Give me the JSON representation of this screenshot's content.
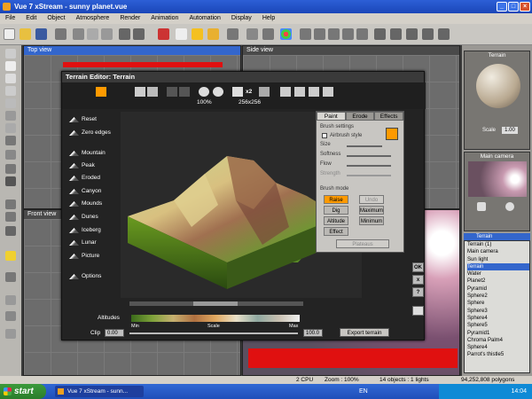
{
  "window": {
    "title": "Vue 7 xStream - sunny planet.vue"
  },
  "menu": [
    "File",
    "Edit",
    "Object",
    "Atmosphere",
    "Render",
    "Animation",
    "Automation",
    "Display",
    "Help"
  ],
  "viewports": {
    "top": "Top view",
    "side": "Side view",
    "front": "Front view",
    "main_camera": "Main camera"
  },
  "terrain_editor": {
    "title": "Terrain Editor: Terrain",
    "zoom": "100%",
    "resolution": "256x256",
    "x2_label": "x2",
    "left_items": [
      "Reset",
      "Zero edges",
      "Mountain",
      "Peak",
      "Eroded",
      "Canyon",
      "Mounds",
      "Dunes",
      "Iceberg",
      "Lunar",
      "Picture",
      "Options"
    ],
    "tabs": [
      "Paint",
      "Erode",
      "Effects"
    ],
    "brush_settings": {
      "heading": "Brush settings",
      "airbrush": "Airbrush style",
      "size": "Size",
      "softness": "Softness",
      "flow": "Flow",
      "strength": "Strength"
    },
    "brush_mode": {
      "heading": "Brush mode",
      "buttons": [
        "Raise",
        "Undo",
        "Dig",
        "Maximum",
        "Altitude",
        "Minimum",
        "Effect"
      ],
      "dropdown": "Plateaus"
    },
    "altitudes": {
      "label": "Altitudes",
      "min": "Min",
      "scale": "Scale",
      "max": "Max"
    },
    "clip": {
      "label": "Clip",
      "low": "0.00",
      "high": "100.0"
    },
    "export_button": "Export terrain",
    "side_buttons": [
      "OK",
      "x",
      "?"
    ]
  },
  "right_panel": {
    "material_title": "Terrain",
    "scale_label": "Scale",
    "scale_value": "1.00",
    "camera_title": "Main camera",
    "layer_tab": "Terrain",
    "tree": [
      "Terrain (1)",
      "Main camera",
      "Sun light",
      "Terrain",
      "Water",
      "Planet2",
      "Pyramid",
      "Sphere2",
      "Sphere",
      "Sphere3",
      "Sphere4",
      "Sphere5",
      "Pyramid1",
      "Chroma Palm4",
      "Sphere4",
      "Parrot's thistle5"
    ]
  },
  "status": {
    "cpu": "2 CPU",
    "zoom": "Zoom : 100%",
    "objects": "14 objects : 1 lights",
    "polygons": "94,252,808 polygons"
  },
  "taskbar": {
    "start": "start",
    "task_item": "Vue 7 xStream - sunn...",
    "lang": "EN",
    "clock": "14:04"
  }
}
